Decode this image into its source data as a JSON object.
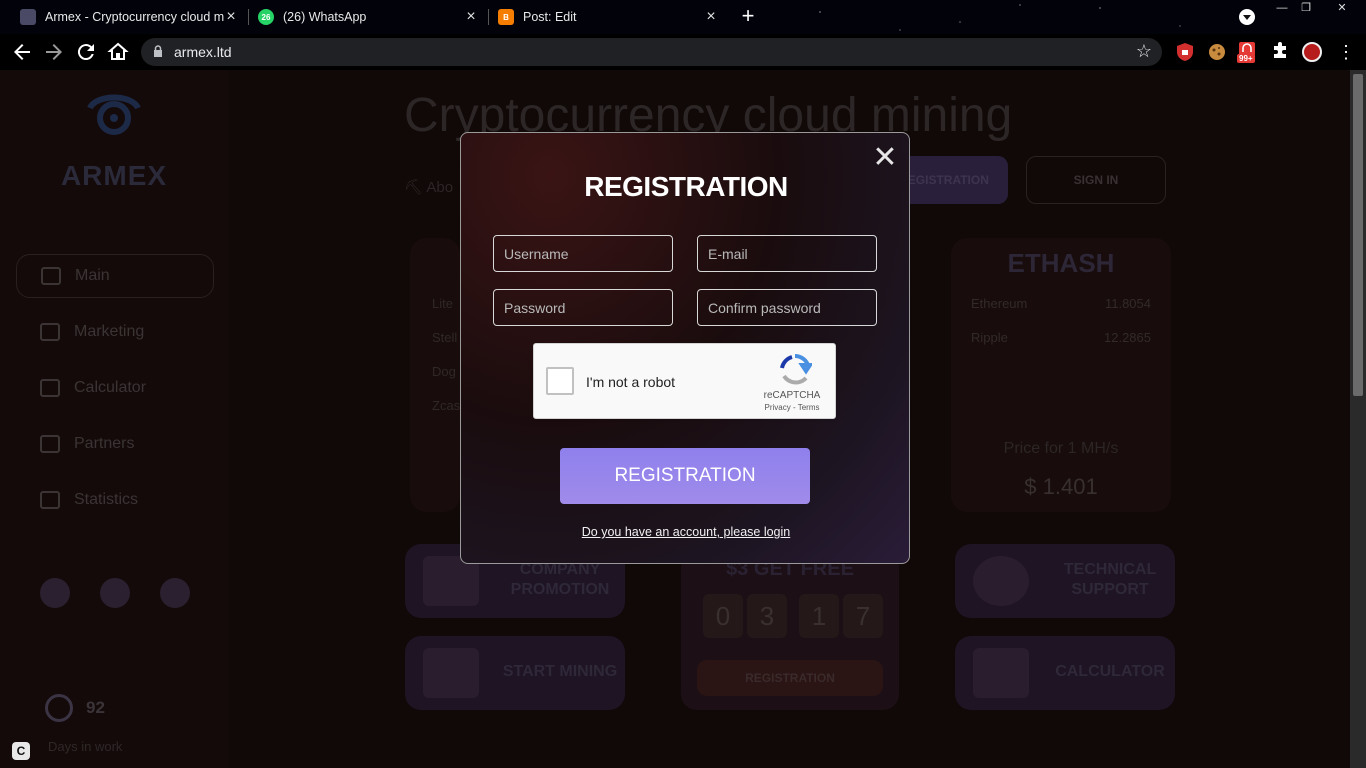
{
  "browser": {
    "tabs": [
      {
        "title": "Armex - Cryptocurrency cloud m",
        "favicon": "armex-favicon"
      },
      {
        "title": "(26) WhatsApp",
        "favicon": "whatsapp-favicon",
        "badge": "26"
      },
      {
        "title": "Post: Edit",
        "favicon": "blogger-favicon"
      }
    ],
    "url": "armex.ltd",
    "extension_badge": "99+"
  },
  "sidebar": {
    "logo_text": "ARMEX",
    "items": [
      {
        "label": "Main",
        "icon": "home-icon"
      },
      {
        "label": "Marketing",
        "icon": "chart-icon"
      },
      {
        "label": "Calculator",
        "icon": "calculator-icon"
      },
      {
        "label": "Partners",
        "icon": "users-icon"
      },
      {
        "label": "Statistics",
        "icon": "bars-icon"
      }
    ],
    "days_value": "92",
    "days_label": "Days in work"
  },
  "hero": {
    "title": "Cryptocurrency cloud mining",
    "about_label": "Abo",
    "registration_label": "REGISTRATION",
    "signin_label": "SIGN IN"
  },
  "left_card": {
    "rows": [
      "Lite",
      "Stell",
      "Dog",
      "Zcas"
    ]
  },
  "ethash_card": {
    "title": "ETHASH",
    "rows": [
      {
        "name": "Ethereum",
        "value": "11.8054"
      },
      {
        "name": "Ripple",
        "value": "12.2865"
      }
    ],
    "price_label": "Price for 1 MH/s",
    "price_value": "$ 1.401"
  },
  "tiles": {
    "promotion": "COMPANY PROMOTION",
    "support": "TECHNICAL SUPPORT",
    "start": "START MINING",
    "calculator": "CALCULATOR"
  },
  "promo": {
    "title": "$3 GET FREE",
    "digits": [
      "0",
      "3",
      "1",
      "7"
    ],
    "button": "REGISTRATION"
  },
  "modal": {
    "title": "REGISTRATION",
    "username_placeholder": "Username",
    "email_placeholder": "E-mail",
    "password_placeholder": "Password",
    "confirm_placeholder": "Confirm password",
    "captcha_label": "I'm not a robot",
    "captcha_brand": "reCAPTCHA",
    "captcha_terms": "Privacy - Terms",
    "submit_label": "REGISTRATION",
    "login_link": "Do you have an account, please login"
  },
  "colors": {
    "accent": "#8e80ec",
    "page_bg": "#110808",
    "modal_border": "#9a9a9a"
  }
}
